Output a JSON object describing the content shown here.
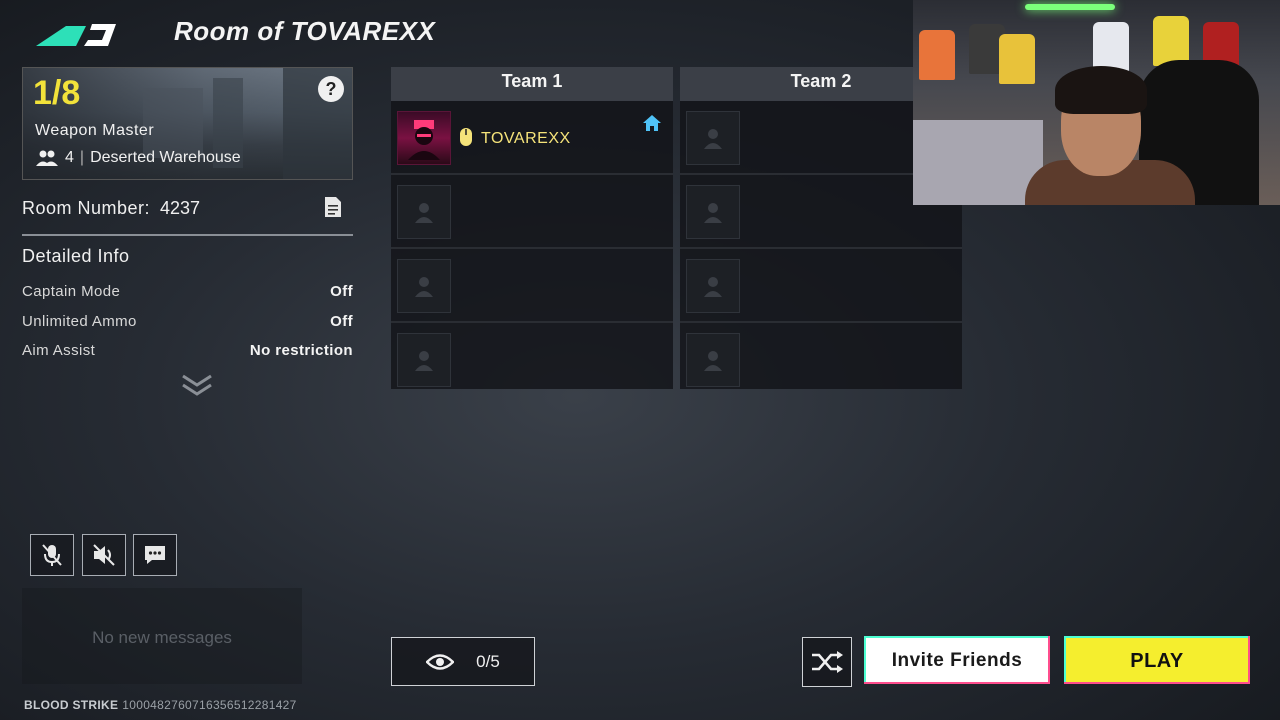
{
  "header": {
    "room_title": "Room of TOVAREXX"
  },
  "mode_card": {
    "player_count": "1/8",
    "help_label": "?",
    "mode_name": "Weapon Master",
    "team_size": "4",
    "map_name": "Deserted Warehouse"
  },
  "room": {
    "label": "Room Number:",
    "number": "4237"
  },
  "detailed_info": {
    "title": "Detailed Info",
    "rows": [
      {
        "key": "Captain Mode",
        "value": "Off"
      },
      {
        "key": "Unlimited Ammo",
        "value": "Off"
      },
      {
        "key": "Aim Assist",
        "value": "No restriction"
      }
    ]
  },
  "chat": {
    "empty_text": "No new messages"
  },
  "footer": {
    "brand": "BLOOD STRIKE",
    "id": "10004827607163565122814​27"
  },
  "teams": [
    {
      "name": "Team 1",
      "player": "TOVAREXX"
    },
    {
      "name": "Team 2"
    }
  ],
  "spectators": {
    "count": "0/5"
  },
  "buttons": {
    "invite": "Invite Friends",
    "play": "PLAY"
  },
  "colors": {
    "accent_yellow": "#f5ee2e",
    "logo_teal": "#2de0b8",
    "host_icon": "#4fc3f7"
  },
  "icons": [
    "logo-icon",
    "help-icon",
    "group-icon",
    "copy-icon",
    "expand-down-icon",
    "mic-muted-icon",
    "speaker-muted-icon",
    "chat-icon",
    "mouse-icon",
    "home-icon",
    "eye-icon",
    "shuffle-icon",
    "empty-slot-icon"
  ]
}
